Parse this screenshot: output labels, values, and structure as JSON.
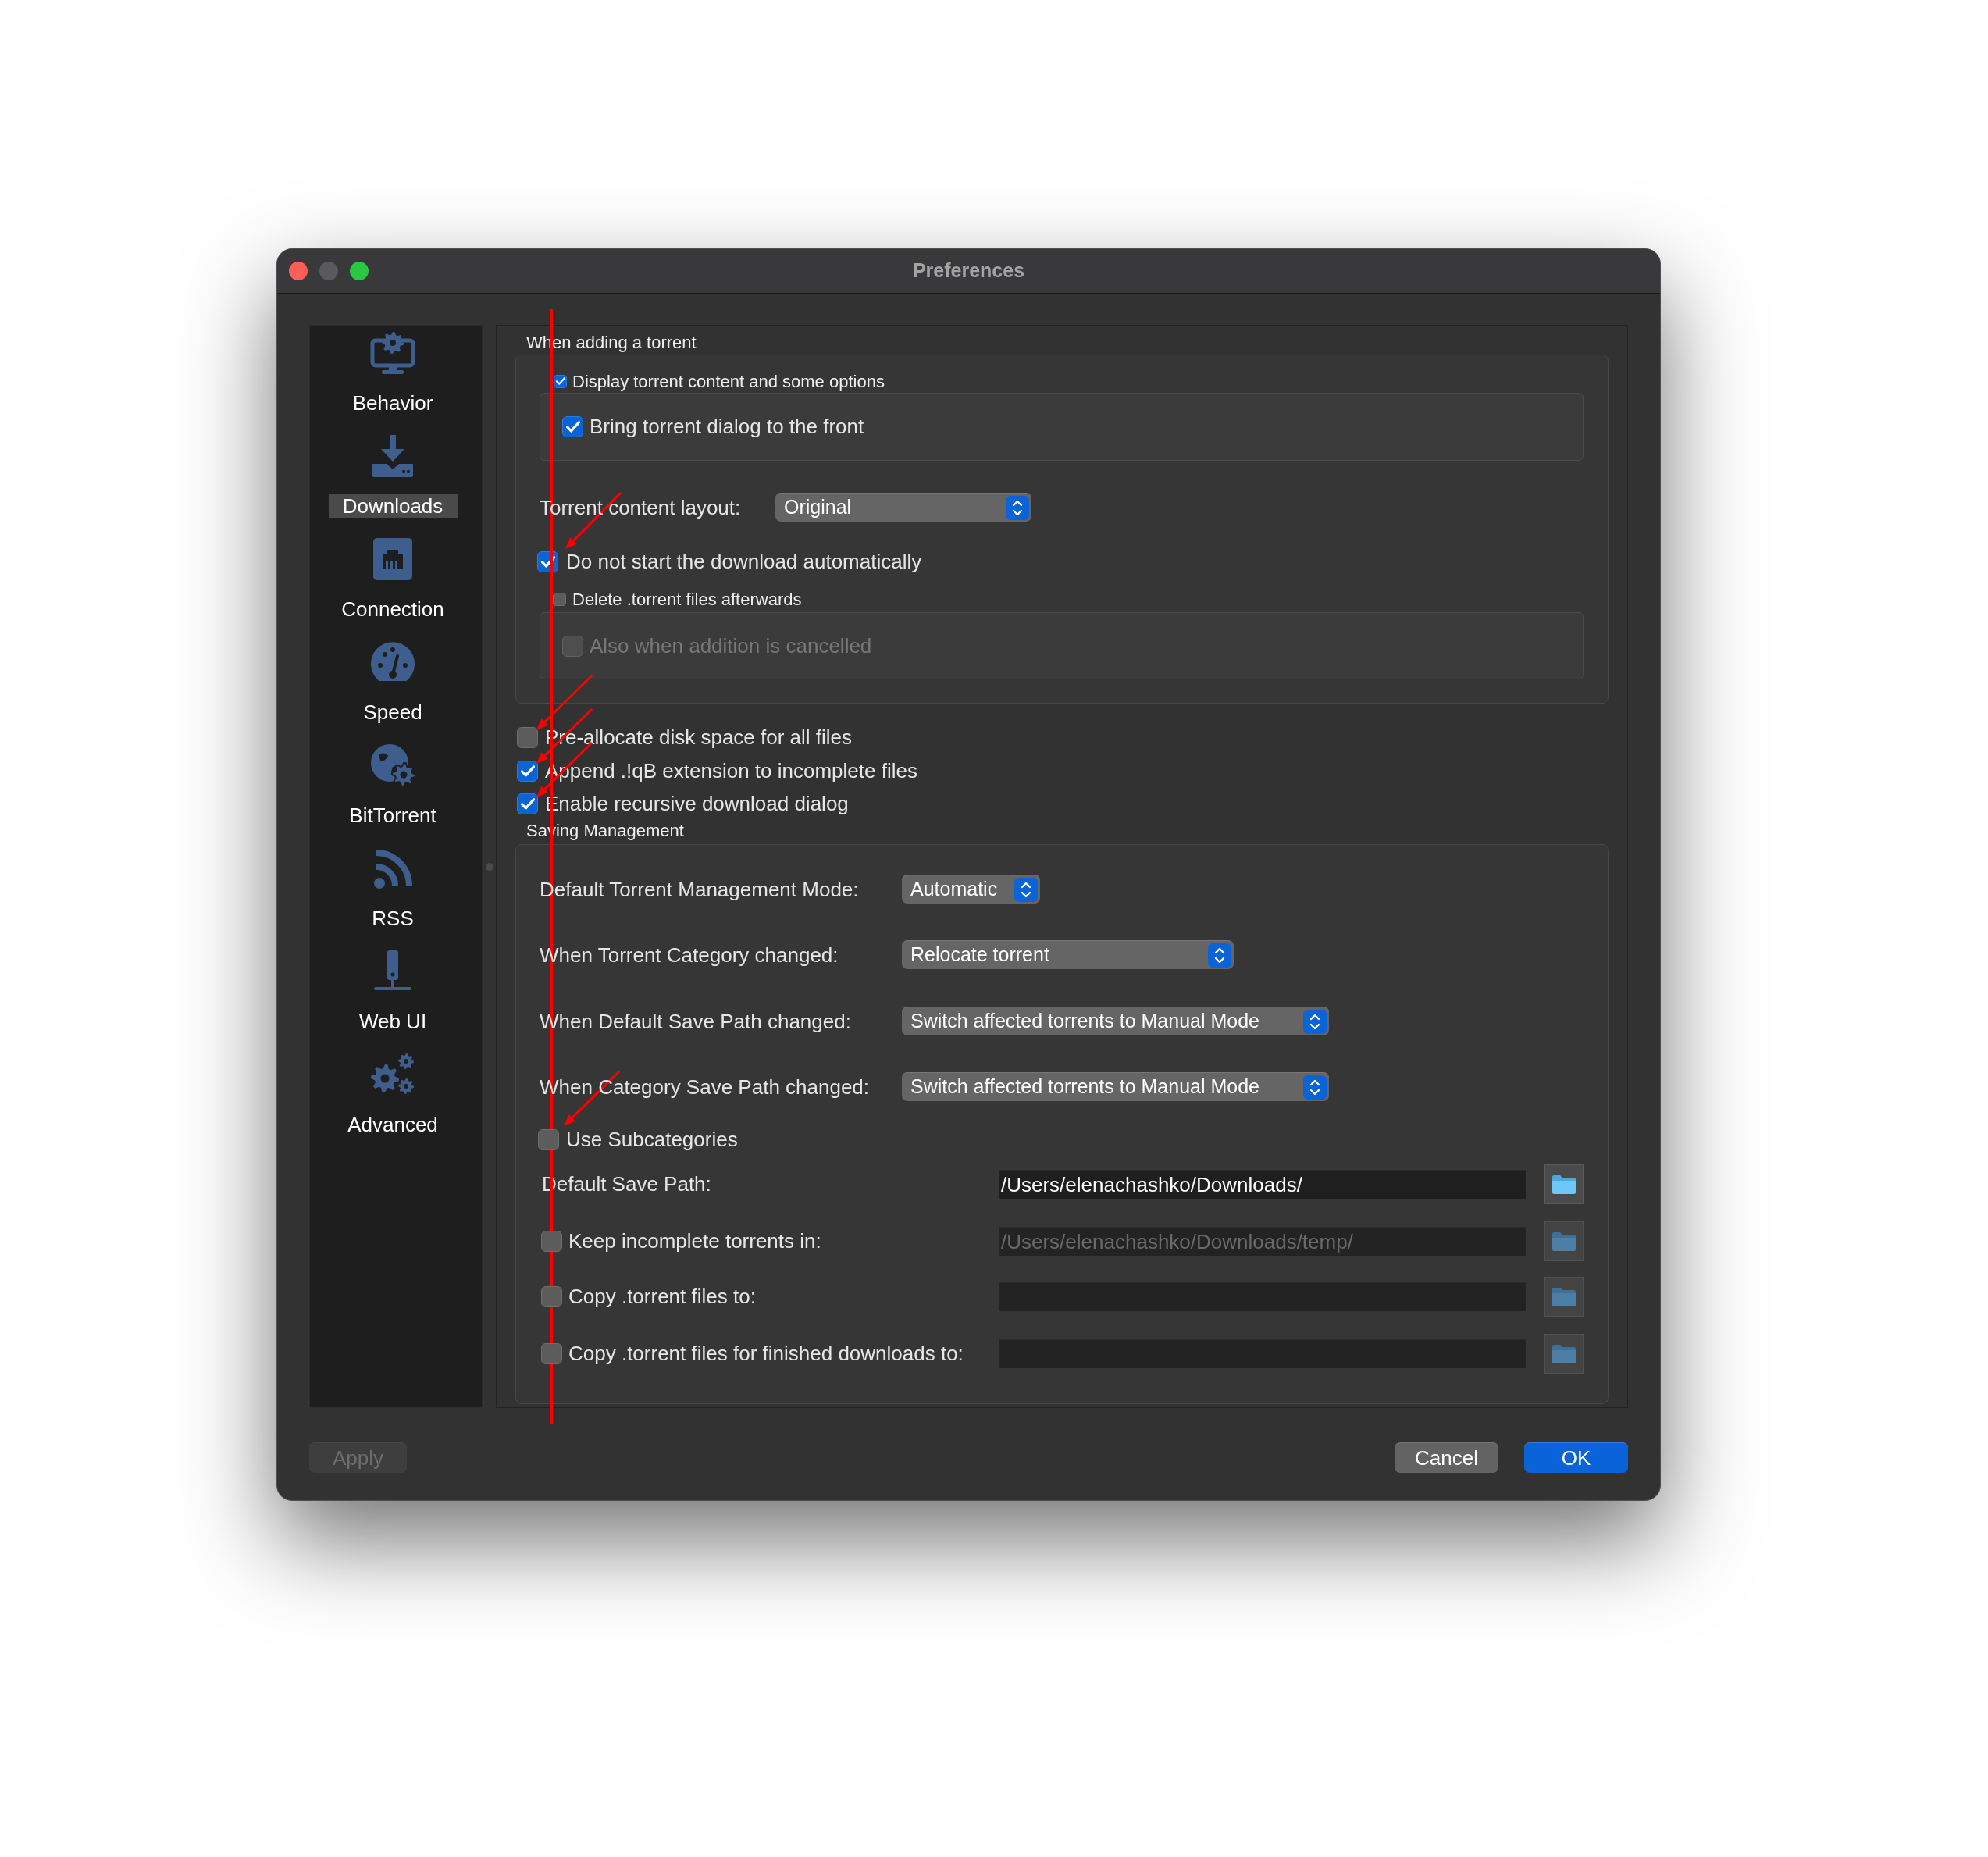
{
  "window": {
    "title": "Preferences",
    "minimize_disabled": true
  },
  "sidebar": {
    "items": [
      {
        "label": "Behavior",
        "selected": false
      },
      {
        "label": "Downloads",
        "selected": true
      },
      {
        "label": "Connection",
        "selected": false
      },
      {
        "label": "Speed",
        "selected": false
      },
      {
        "label": "BitTorrent",
        "selected": false
      },
      {
        "label": "RSS",
        "selected": false
      },
      {
        "label": "Web UI",
        "selected": false
      },
      {
        "label": "Advanced",
        "selected": false
      }
    ]
  },
  "adding_torrent": {
    "title": "When adding a torrent",
    "display_group": {
      "label": "Display torrent content and some options",
      "checked": true,
      "options": [
        {
          "label": "Bring torrent dialog to the front",
          "checked": true,
          "disabled": false
        }
      ]
    },
    "content_layout": {
      "label": "Torrent content layout:",
      "value": "Original"
    },
    "do_not_start": {
      "label": "Do not start the download automatically",
      "checked": true
    },
    "delete_group": {
      "label": "Delete .torrent files afterwards",
      "checked": false,
      "options": [
        {
          "label": "Also when addition is cancelled",
          "checked": false,
          "disabled": true
        }
      ]
    }
  },
  "options": [
    {
      "label": "Pre-allocate disk space for all files",
      "checked": false
    },
    {
      "label": "Append .!qB extension to incomplete files",
      "checked": true
    },
    {
      "label": "Enable recursive download dialog",
      "checked": true
    }
  ],
  "saving_management": {
    "title": "Saving Management",
    "selects": [
      {
        "label": "Default Torrent Management Mode:",
        "value": "Automatic"
      },
      {
        "label": "When Torrent Category changed:",
        "value": "Relocate torrent"
      },
      {
        "label": "When Default Save Path changed:",
        "value": "Switch affected torrents to Manual Mode"
      },
      {
        "label": "When Category Save Path changed:",
        "value": "Switch affected torrents to Manual Mode"
      }
    ],
    "use_subcategories": {
      "label": "Use Subcategories",
      "checked": false
    },
    "paths": [
      {
        "kind": "plain",
        "label": "Default Save Path:",
        "value": "/Users/elenachashko/Downloads/",
        "disabled": false
      },
      {
        "kind": "checkbox",
        "label": "Keep incomplete torrents in:",
        "checked": false,
        "value": "/Users/elenachashko/Downloads/temp/",
        "disabled": true
      },
      {
        "kind": "checkbox",
        "label": "Copy .torrent files to:",
        "checked": false,
        "disabled": true
      },
      {
        "kind": "checkbox",
        "label": "Copy .torrent files for finished downloads to:",
        "checked": false,
        "disabled": true
      }
    ]
  },
  "buttons": [
    {
      "label": "Apply",
      "kind": "secondary",
      "disabled": true
    },
    {
      "label": "Cancel",
      "kind": "secondary",
      "disabled": false
    },
    {
      "label": "OK",
      "kind": "default",
      "disabled": false
    }
  ]
}
